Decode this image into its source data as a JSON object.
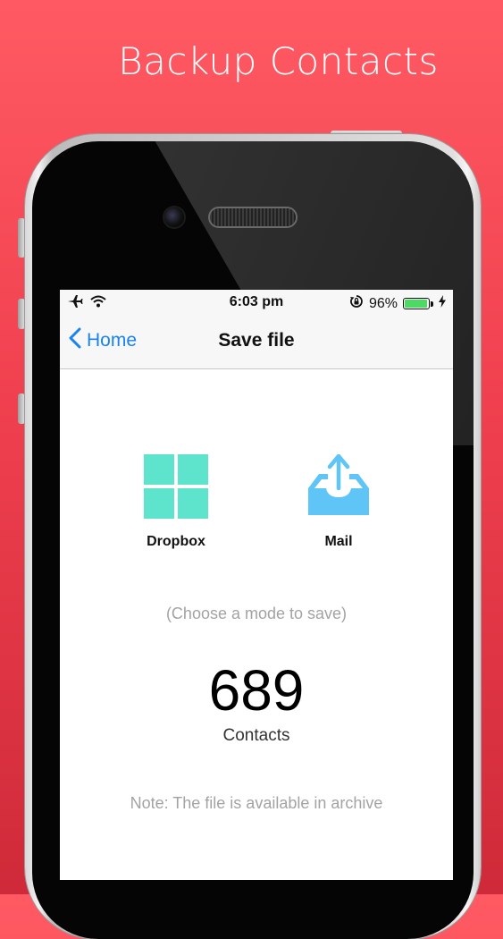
{
  "promo": {
    "headline": "Backup Contacts"
  },
  "status_bar": {
    "time": "6:03 pm",
    "battery_percent": "96%",
    "battery_level": 0.96,
    "icons": [
      "airplane-icon",
      "wifi-icon",
      "rotation-lock-icon",
      "charging-icon"
    ]
  },
  "nav": {
    "back_label": "Home",
    "title": "Save file"
  },
  "options": [
    {
      "label": "Dropbox",
      "icon": "dropbox-icon",
      "color": "#5ee4cd"
    },
    {
      "label": "Mail",
      "icon": "mail-tray-icon",
      "color": "#5ec5f6"
    }
  ],
  "content": {
    "hint": "(Choose a mode to save)",
    "count": "689",
    "count_label": "Contacts",
    "note": "Note: The file is available in archive"
  },
  "colors": {
    "accent": "#1a83f0",
    "battery": "#4cd964"
  }
}
